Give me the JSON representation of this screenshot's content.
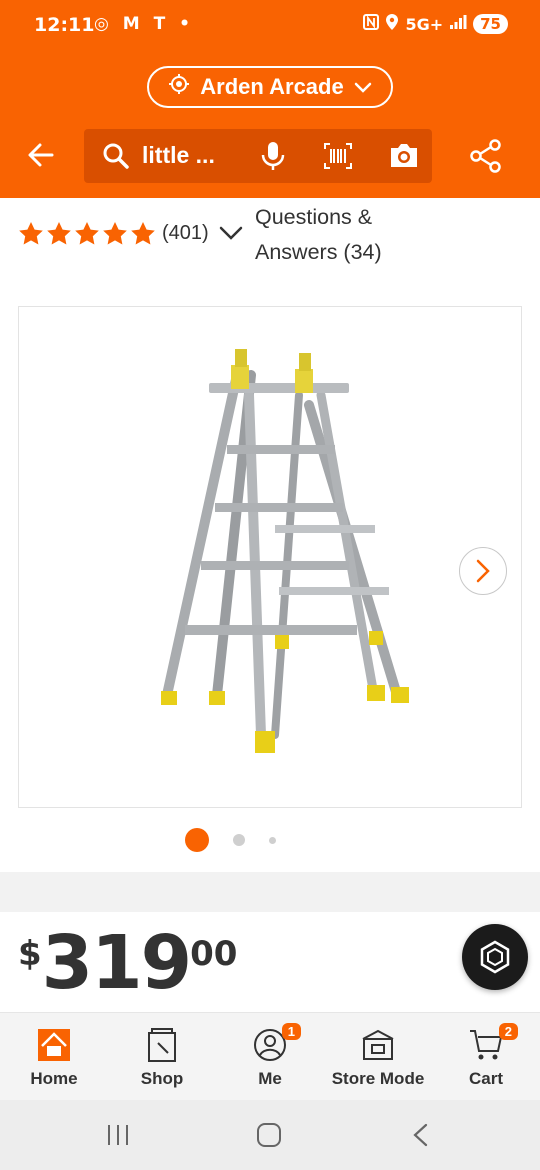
{
  "status_bar": {
    "time": "12:11",
    "left_icons": "◎ M Τ •",
    "network": "5G+",
    "battery": "75",
    "icons": [
      "nfc-icon",
      "location-icon",
      "signal-icon",
      "battery-icon"
    ]
  },
  "header": {
    "location": "Arden Arcade",
    "search_text": "little ...",
    "icons": [
      "back-arrow-icon",
      "search-icon",
      "mic-icon",
      "barcode-icon",
      "camera-icon",
      "share-icon"
    ]
  },
  "ratings": {
    "stars": 5,
    "review_count": "(401)",
    "qa_label": "Questions & Answers (34)"
  },
  "gallery": {
    "image_count": 3,
    "active_index": 0,
    "product_image": "aluminum multi-position ladder"
  },
  "price": {
    "currency": "$",
    "dollars": "319",
    "cents": "00"
  },
  "bottom_nav": {
    "items": [
      {
        "label": "Home",
        "icon": "home-depot-logo-icon",
        "badge": ""
      },
      {
        "label": "Shop",
        "icon": "shop-icon",
        "badge": ""
      },
      {
        "label": "Me",
        "icon": "profile-icon",
        "badge": "1"
      },
      {
        "label": "Store Mode",
        "icon": "store-icon",
        "badge": ""
      },
      {
        "label": "Cart",
        "icon": "cart-icon",
        "badge": "2"
      }
    ]
  },
  "colors": {
    "brand": "#f96302",
    "brand_dark": "#d94f00",
    "text": "#333333"
  }
}
